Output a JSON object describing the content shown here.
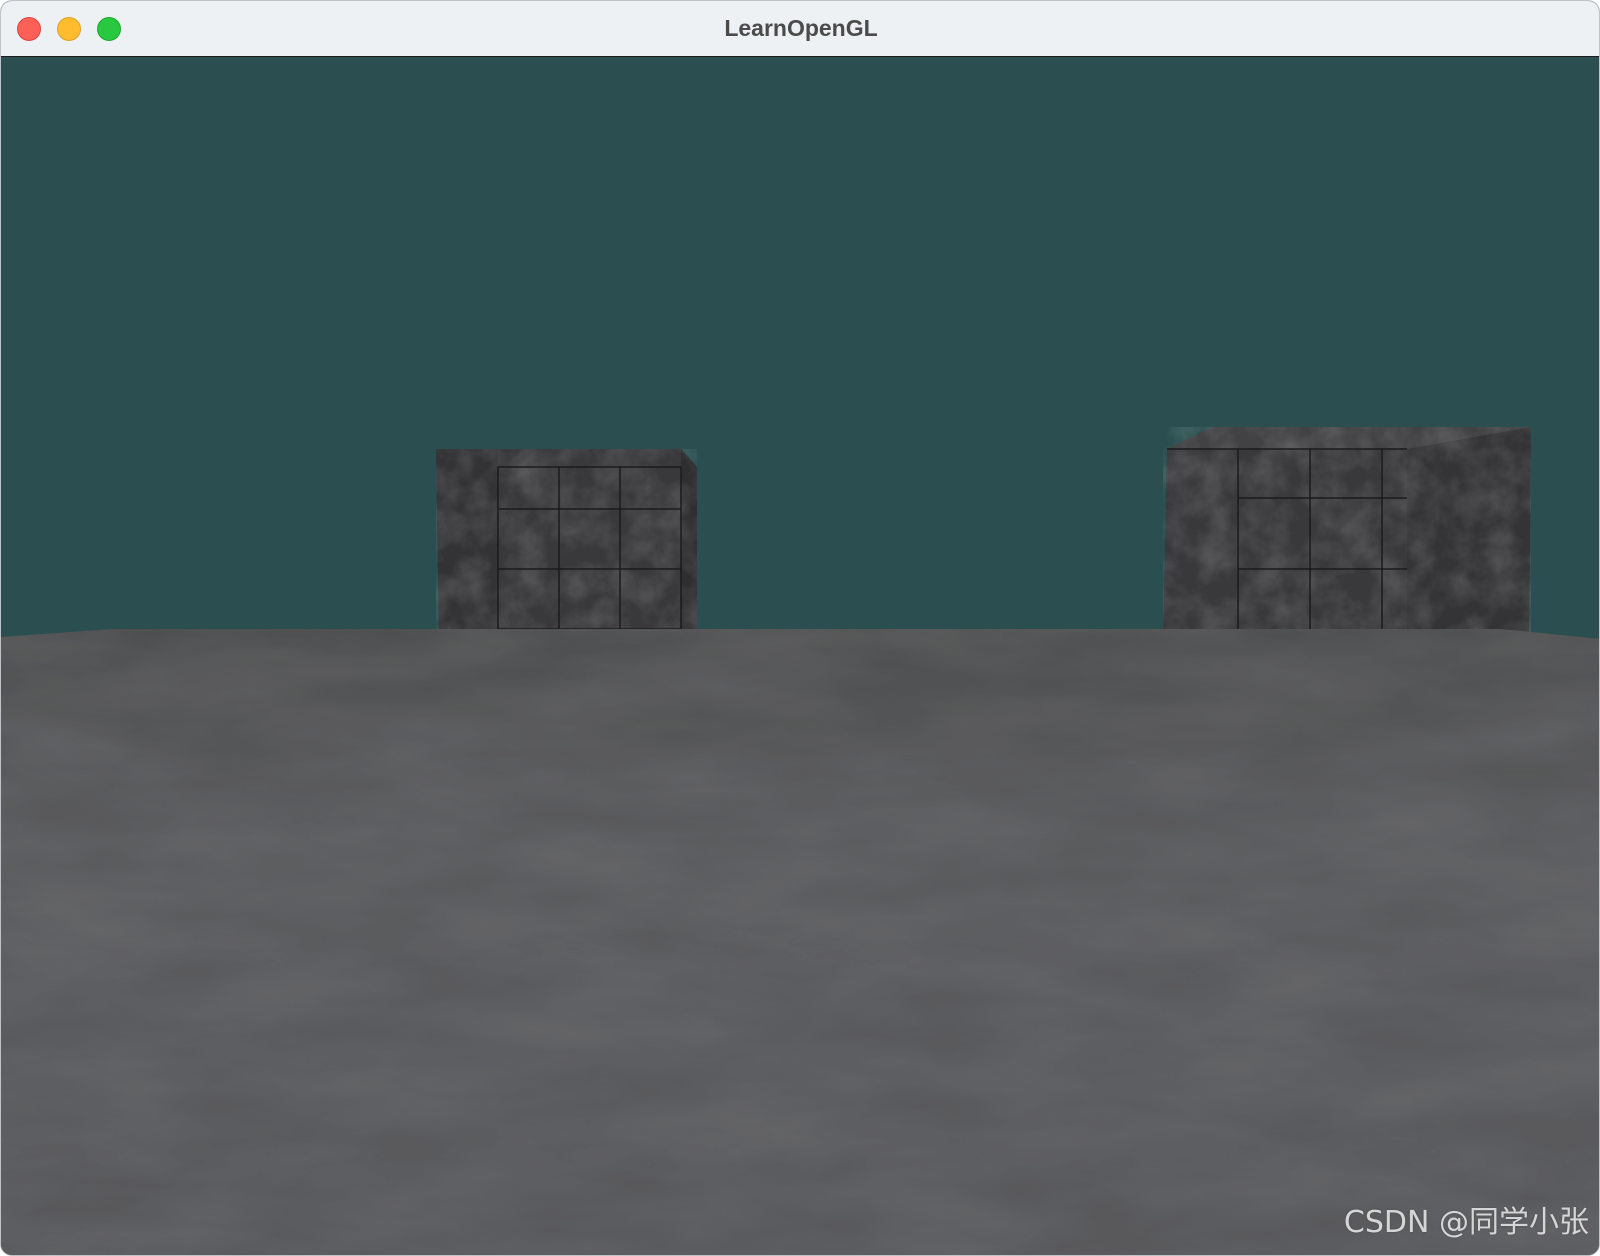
{
  "window": {
    "title": "LearnOpenGL"
  },
  "traffic_lights": {
    "close_icon": "close-icon",
    "minimize_icon": "minimize-icon",
    "zoom_icon": "zoom-icon"
  },
  "scene": {
    "clear_color": "#2b4f50",
    "floor_color": "#55585b",
    "cube_color": "#3a3a3c",
    "objects": [
      "floor",
      "cube",
      "cube"
    ]
  },
  "watermark": {
    "text": "CSDN @同学小张"
  }
}
